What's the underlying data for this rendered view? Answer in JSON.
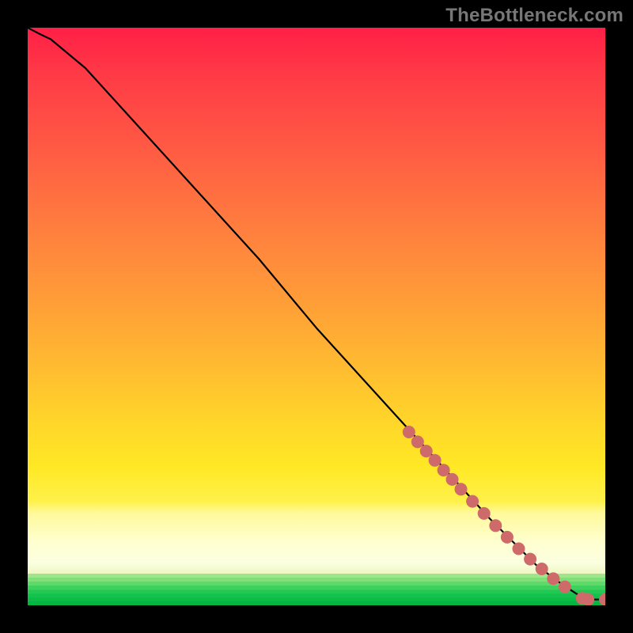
{
  "watermark": "TheBottleneck.com",
  "chart_data": {
    "type": "line",
    "title": "",
    "xlabel": "",
    "ylabel": "",
    "xlim": [
      0,
      100
    ],
    "ylim": [
      0,
      100
    ],
    "grid": false,
    "series": [
      {
        "name": "bottleneck-curve",
        "x": [
          0,
          4,
          10,
          20,
          30,
          40,
          50,
          60,
          70,
          80,
          88,
          92,
          95,
          97,
          100
        ],
        "y": [
          100,
          98,
          93,
          82,
          71,
          60,
          48,
          37,
          26,
          15,
          7,
          4,
          2,
          1,
          1
        ]
      }
    ],
    "markers": [
      {
        "name": "highlighted-segment",
        "color": "#cf6a6a",
        "points": [
          {
            "x": 66,
            "y": 30
          },
          {
            "x": 67.5,
            "y": 28.3
          },
          {
            "x": 69,
            "y": 26.7
          },
          {
            "x": 70.5,
            "y": 25.1
          },
          {
            "x": 72,
            "y": 23.4
          },
          {
            "x": 73.5,
            "y": 21.8
          },
          {
            "x": 75,
            "y": 20.1
          },
          {
            "x": 77,
            "y": 18
          },
          {
            "x": 79,
            "y": 15.9
          },
          {
            "x": 81,
            "y": 13.8
          },
          {
            "x": 83,
            "y": 11.8
          },
          {
            "x": 85,
            "y": 9.8
          },
          {
            "x": 87,
            "y": 8
          },
          {
            "x": 89,
            "y": 6.3
          },
          {
            "x": 91,
            "y": 4.6
          },
          {
            "x": 93,
            "y": 3.2
          }
        ]
      },
      {
        "name": "tail-markers",
        "color": "#cf6a6a",
        "points": [
          {
            "x": 96,
            "y": 1.2
          },
          {
            "x": 97,
            "y": 1.0
          },
          {
            "x": 100,
            "y": 1.0
          }
        ]
      }
    ],
    "background_gradient": {
      "type": "heat",
      "stops": [
        {
          "pos": 0.0,
          "color": "#ff1f46"
        },
        {
          "pos": 0.46,
          "color": "#ff9a38"
        },
        {
          "pos": 0.76,
          "color": "#ffe824"
        },
        {
          "pos": 0.9,
          "color": "#ffffcf"
        },
        {
          "pos": 0.97,
          "color": "#3dd05c"
        },
        {
          "pos": 1.0,
          "color": "#05b541"
        }
      ]
    }
  }
}
